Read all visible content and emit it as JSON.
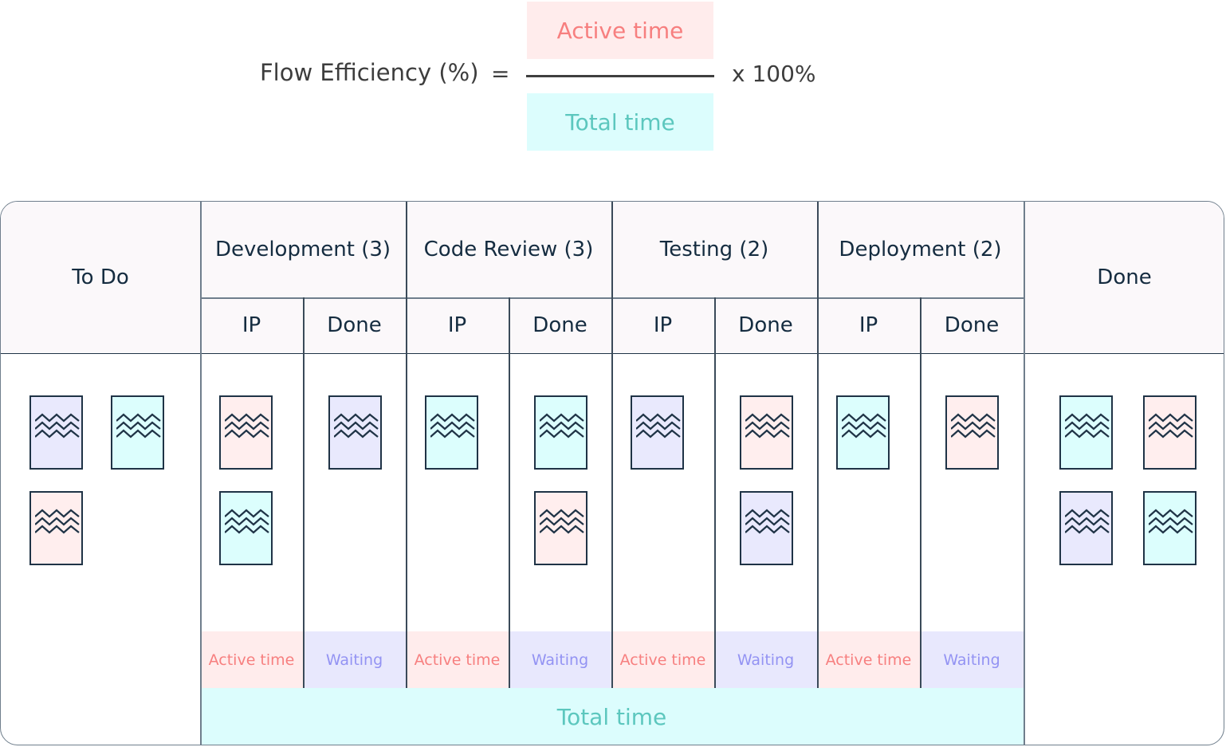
{
  "formula": {
    "label": "Flow Efficiency (%)",
    "equals": "=",
    "numerator": "Active time",
    "denominator": "Total time",
    "multiplier": "x 100%"
  },
  "colors": {
    "active": "#ffecec",
    "active_text": "#f77f7f",
    "waiting": "#e8e8fd",
    "waiting_text": "#9393f3",
    "total": "#dcfdfd",
    "total_text": "#5cc7be",
    "card_pink": "#ffeeee",
    "card_lavender": "#e9e9fd",
    "card_cyan": "#dcfefd"
  },
  "board": {
    "columns": [
      {
        "title": "To Do",
        "cards": [
          "lavender",
          "cyan",
          "pink"
        ]
      },
      {
        "title": "Development (3)",
        "sub": [
          {
            "title": "IP",
            "cards": [
              "pink",
              "cyan"
            ],
            "time": "Active time"
          },
          {
            "title": "Done",
            "cards": [
              "lavender"
            ],
            "time": "Waiting"
          }
        ]
      },
      {
        "title": "Code Review (3)",
        "sub": [
          {
            "title": "IP",
            "cards": [
              "cyan"
            ],
            "time": "Active time"
          },
          {
            "title": "Done",
            "cards": [
              "cyan",
              "pink"
            ],
            "time": "Waiting"
          }
        ]
      },
      {
        "title": "Testing (2)",
        "sub": [
          {
            "title": "IP",
            "cards": [
              "lavender"
            ],
            "time": "Active time"
          },
          {
            "title": "Done",
            "cards": [
              "pink",
              "lavender"
            ],
            "time": "Waiting"
          }
        ]
      },
      {
        "title": "Deployment (2)",
        "sub": [
          {
            "title": "IP",
            "cards": [
              "cyan"
            ],
            "time": "Active time"
          },
          {
            "title": "Done",
            "cards": [
              "pink"
            ],
            "time": "Waiting"
          }
        ]
      },
      {
        "title": "Done",
        "cards": [
          "cyan",
          "pink",
          "lavender",
          "cyan"
        ]
      }
    ],
    "total_label": "Total time"
  }
}
